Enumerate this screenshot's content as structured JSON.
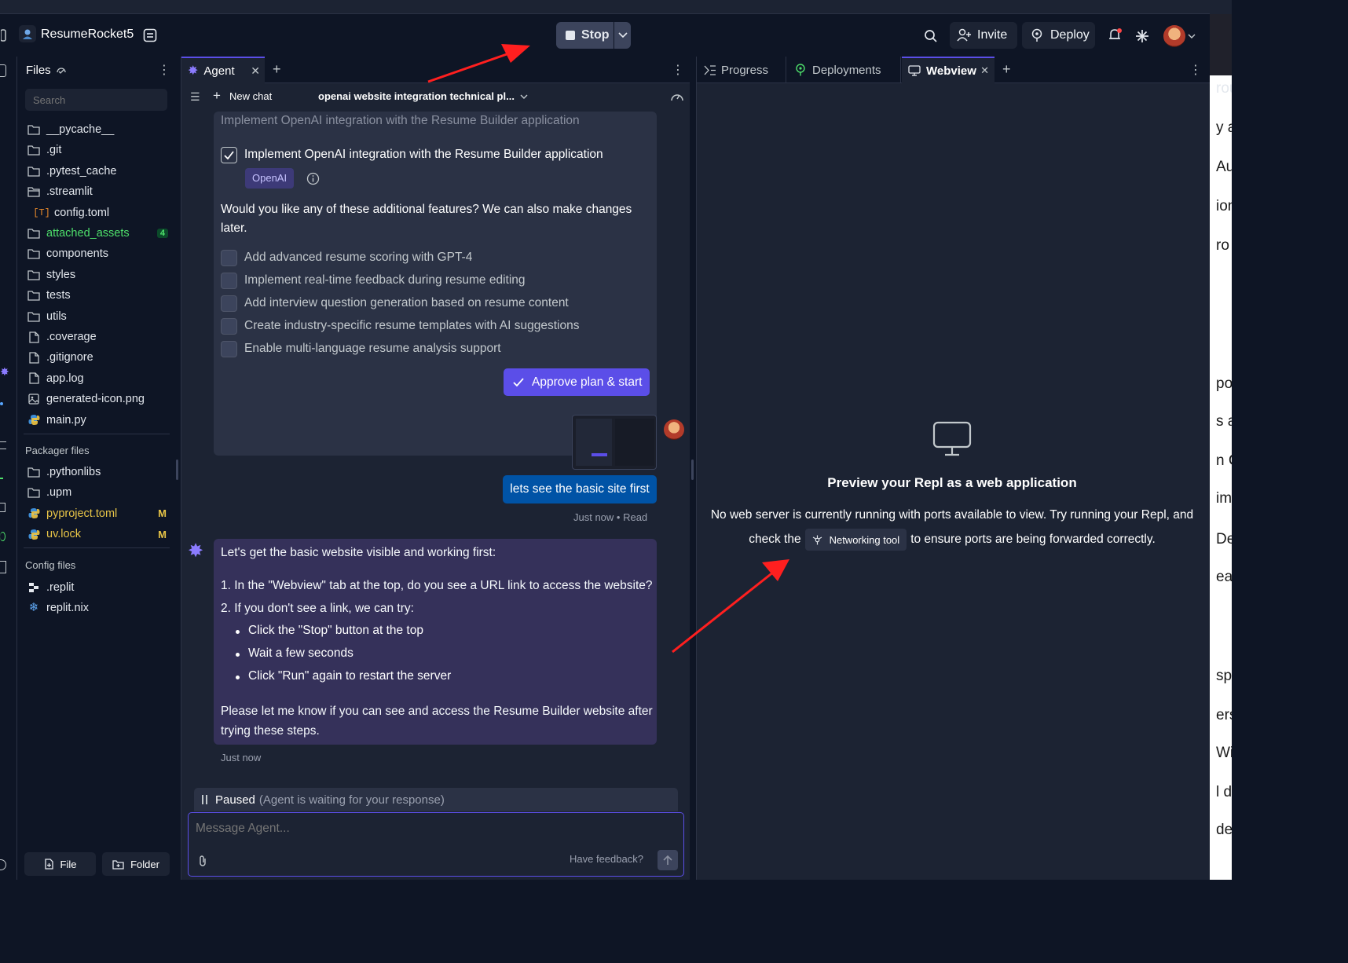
{
  "header": {
    "project_name": "ResumeRocket5",
    "stop_label": "Stop",
    "invite_label": "Invite",
    "deploy_label": "Deploy"
  },
  "files": {
    "title": "Files",
    "search_placeholder": "Search",
    "items": [
      {
        "name": "__pycache__",
        "type": "folder"
      },
      {
        "name": ".git",
        "type": "folder"
      },
      {
        "name": ".pytest_cache",
        "type": "folder"
      },
      {
        "name": ".streamlit",
        "type": "folder-open"
      },
      {
        "name": "config.toml",
        "type": "toml"
      },
      {
        "name": "attached_assets",
        "type": "folder",
        "badge": "4"
      },
      {
        "name": "components",
        "type": "folder"
      },
      {
        "name": "styles",
        "type": "folder"
      },
      {
        "name": "tests",
        "type": "folder"
      },
      {
        "name": "utils",
        "type": "folder"
      },
      {
        "name": ".coverage",
        "type": "file"
      },
      {
        "name": ".gitignore",
        "type": "file"
      },
      {
        "name": "app.log",
        "type": "file"
      },
      {
        "name": "generated-icon.png",
        "type": "image"
      },
      {
        "name": "main.py",
        "type": "python"
      }
    ],
    "packager_label": "Packager files",
    "packager_items": [
      {
        "name": ".pythonlibs",
        "type": "folder"
      },
      {
        "name": ".upm",
        "type": "folder"
      },
      {
        "name": "pyproject.toml",
        "type": "python",
        "badge": "M"
      },
      {
        "name": "uv.lock",
        "type": "python",
        "badge": "M"
      }
    ],
    "config_label": "Config files",
    "config_items": [
      {
        "name": ".replit",
        "type": "replit"
      },
      {
        "name": "replit.nix",
        "type": "nix"
      }
    ],
    "new_file_label": "File",
    "new_folder_label": "Folder"
  },
  "agent": {
    "tab_label": "Agent",
    "new_chat_label": "New chat",
    "chat_title": "openai website integration technical pl...",
    "faded_line": "Implement OpenAI integration with the Resume Builder application",
    "checked_item": "Implement OpenAI integration with the Resume Builder application",
    "openai_tag": "OpenAI",
    "question": "Would you like any of these additional features? We can also make changes later.",
    "options": [
      "Add advanced resume scoring with GPT-4",
      "Implement real-time feedback during resume editing",
      "Add interview question generation based on resume content",
      "Create industry-specific resume templates with AI suggestions",
      "Enable multi-language resume analysis support"
    ],
    "approve_label": "Approve plan & start",
    "user_message": "lets see the basic site first",
    "user_meta": "Just now • Read",
    "reply_intro": "Let's get the basic website visible and working first:",
    "reply_step1": "1. In the \"Webview\" tab at the top, do you see a URL link to access the website?",
    "reply_step2": "2. If you don't see a link, we can try:",
    "reply_bullets": [
      "Click the \"Stop\" button at the top",
      "Wait a few seconds",
      "Click \"Run\" again to restart the server"
    ],
    "reply_outro": "Please let me know if you can see and access the Resume Builder website after trying these steps.",
    "reply_meta": "Just now",
    "paused_label": "Paused",
    "paused_detail": "(Agent is waiting for your response)",
    "input_placeholder": "Message Agent...",
    "feedback_label": "Have feedback?"
  },
  "webview": {
    "tabs": [
      "Progress",
      "Deployments",
      "Webview"
    ],
    "heading": "Preview your Repl as a web application",
    "body_line1": "No web server is currently running with ports available to view. Try running your Repl, and",
    "body_pre": "check the",
    "networking_label": "Networking tool",
    "body_post": "to ensure ports are being forwarded correctly."
  },
  "right_edge_fragments": [
    "rou",
    "y ar",
    "Au",
    "ion",
    "ro s",
    "por",
    "s ar",
    "n C",
    "ime",
    "Dev",
    "eali",
    "spa",
    "ersa",
    "Wi",
    "l de",
    "de"
  ],
  "colors": {
    "bg": "#0e1525",
    "panel": "#1c2333",
    "card": "#2b3245",
    "accent": "#5b4ee8",
    "user_bubble": "#0053a6",
    "agent_bubble": "#35315a",
    "annotation": "#ff1f1f"
  }
}
